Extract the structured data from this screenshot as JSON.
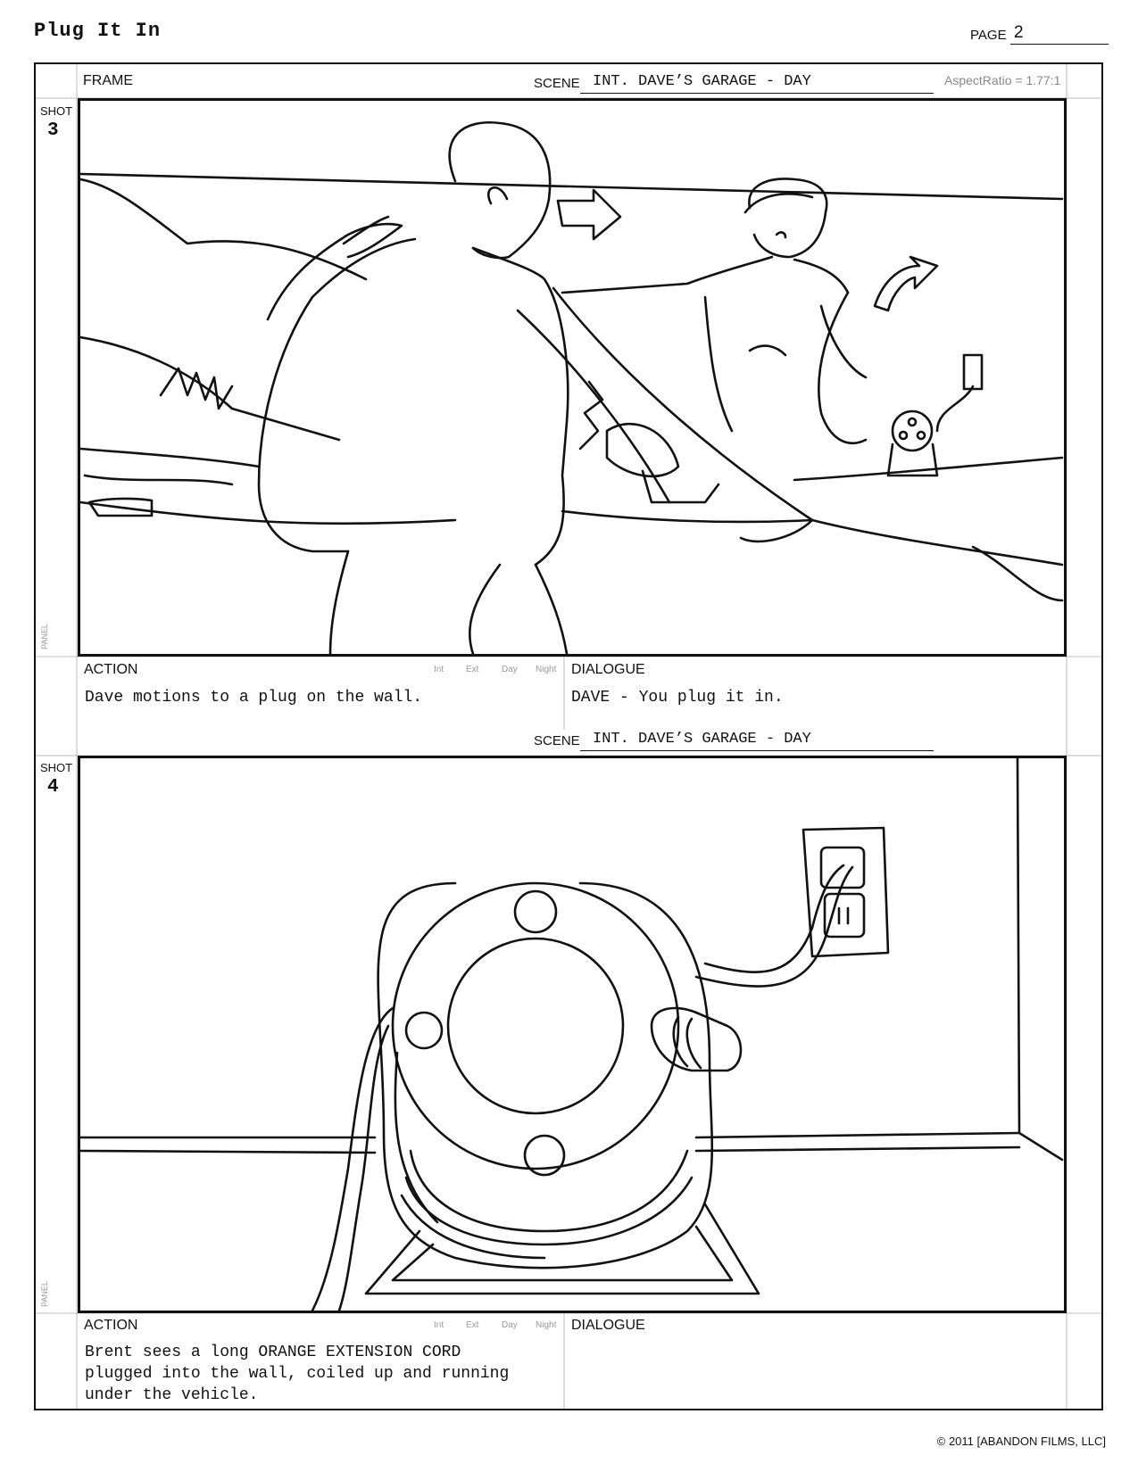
{
  "header": {
    "title": "Plug It In",
    "page_label": "PAGE",
    "page_number": "2"
  },
  "labels": {
    "frame": "FRAME",
    "scene": "SCENE",
    "aspect_ratio": "AspectRatio = 1.77:1",
    "shot": "SHOT",
    "panel": "PANEL",
    "action": "ACTION",
    "dialogue": "DIALOGUE",
    "int": "Int",
    "ext": "Ext",
    "day": "Day",
    "night": "Night"
  },
  "shots": [
    {
      "number": "3",
      "scene": "INT. DAVE’S GARAGE - DAY",
      "action": "Dave motions to a plug on the wall.",
      "dialogue": "DAVE - You plug it in."
    },
    {
      "number": "4",
      "scene": "INT. DAVE’S GARAGE - DAY",
      "action": "Brent sees a long ORANGE EXTENSION CORD\nplugged into the wall, coiled up and running\nunder the vehicle.",
      "dialogue": ""
    }
  ],
  "footer": {
    "copyright": "© 2011 [ABANDON FILMS, LLC]"
  }
}
